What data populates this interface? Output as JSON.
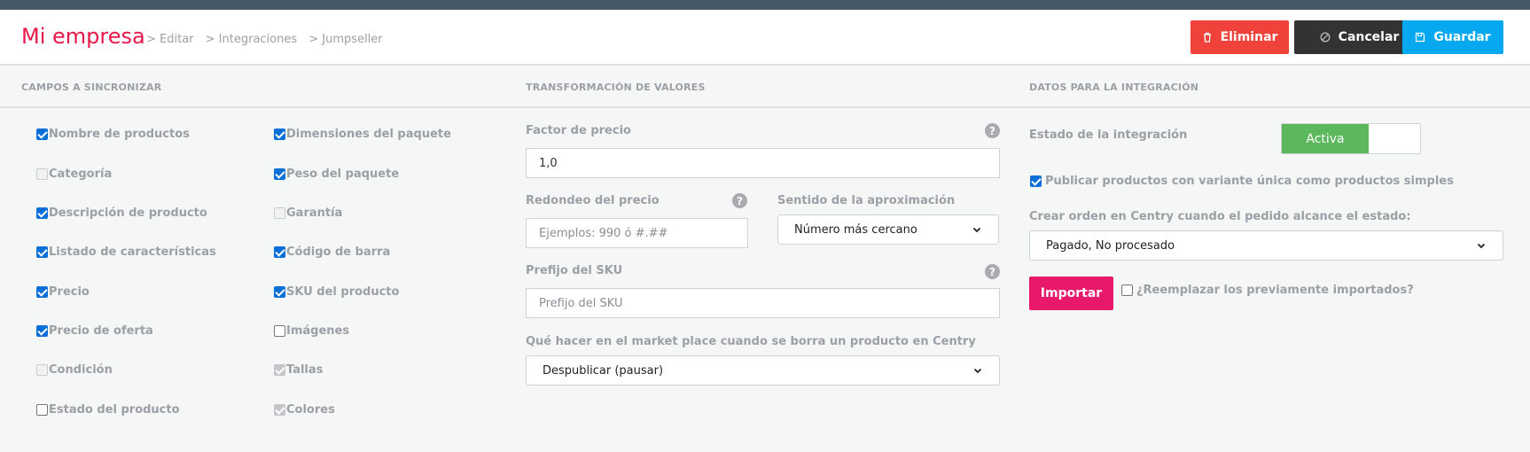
{
  "header": {
    "title": "Mi empresa",
    "breadcrumbs": [
      "> Editar",
      "> Integraciones",
      "> Jumpseller"
    ],
    "buttons": {
      "delete": "Eliminar",
      "cancel": "Cancelar",
      "save": "Guardar"
    }
  },
  "sections": {
    "fields": "CAMPOS A SINCRONIZAR",
    "transform": "TRANSFORMACIÓN DE VALORES",
    "integration": "DATOS PARA LA INTEGRACIÓN"
  },
  "fields_col1": [
    {
      "label": "Nombre de productos",
      "state": "checked"
    },
    {
      "label": "Categoría",
      "state": "disabled"
    },
    {
      "label": "Descripción de producto",
      "state": "checked"
    },
    {
      "label": "Listado de características",
      "state": "checked"
    },
    {
      "label": "Precio",
      "state": "checked"
    },
    {
      "label": "Precio de oferta",
      "state": "checked"
    },
    {
      "label": "Condición",
      "state": "disabled"
    },
    {
      "label": "Estado del producto",
      "state": "unchecked"
    }
  ],
  "fields_col2": [
    {
      "label": "Dimensiones del paquete",
      "state": "checked"
    },
    {
      "label": "Peso del paquete",
      "state": "checked"
    },
    {
      "label": "Garantía",
      "state": "disabled"
    },
    {
      "label": "Código de barra",
      "state": "checked"
    },
    {
      "label": "SKU del producto",
      "state": "checked"
    },
    {
      "label": "Imágenes",
      "state": "unchecked"
    },
    {
      "label": "Tallas",
      "state": "disabled-checked"
    },
    {
      "label": "Colores",
      "state": "disabled-checked"
    }
  ],
  "transform": {
    "price_factor_label": "Factor de precio",
    "price_factor_value": "1,0",
    "rounding_label": "Redondeo del precio",
    "rounding_placeholder": "Ejemplos: 990 ó #.##",
    "approx_label": "Sentido de la aproximación",
    "approx_value": "Número más cercano",
    "sku_prefix_label": "Prefijo del SKU",
    "sku_prefix_placeholder": "Prefijo del SKU",
    "delete_action_label": "Qué hacer en el market place cuando se borra un producto en Centry",
    "delete_action_value": "Despublicar (pausar)"
  },
  "integration": {
    "status_label": "Estado de la integración",
    "status_value": "Activa",
    "publish_single_label": "Publicar productos con variante única como productos simples",
    "order_state_label": "Crear orden en Centry cuando el pedido alcance el estado:",
    "order_state_value": "Pagado, No procesado",
    "import_button": "Importar",
    "replace_label": "¿Reemplazar los previamente importados?"
  },
  "colors": {
    "brand": "#e8194a",
    "danger": "#f0413b",
    "dark": "#333333",
    "primary": "#06a9f0",
    "success": "#5cb85c",
    "import": "#e8196a"
  }
}
